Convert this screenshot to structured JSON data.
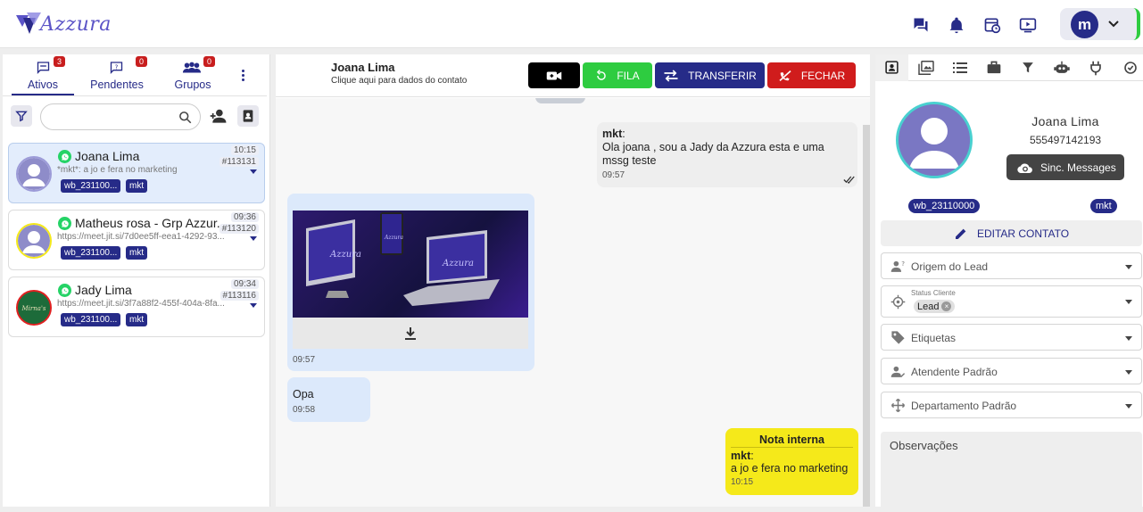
{
  "brand": {
    "name": "Azzura"
  },
  "profile": {
    "initial": "m"
  },
  "left": {
    "tabs": [
      {
        "label": "Ativos",
        "count": "3"
      },
      {
        "label": "Pendentes",
        "count": "0"
      },
      {
        "label": "Grupos",
        "count": "0"
      }
    ],
    "search": {
      "placeholder": "",
      "value": ""
    },
    "tickets": [
      {
        "name": "Joana Lima",
        "message": "*mkt*: a jo e fera no marketing",
        "time": "10:15",
        "number": "#113131",
        "tags": [
          "wb_231100...",
          "mkt"
        ]
      },
      {
        "name": "Matheus rosa - Grp Azzur...",
        "message": "https://meet.jit.si/7d0ee5ff-eea1-4292-93...",
        "time": "09:36",
        "number": "#113120",
        "tags": [
          "wb_231100...",
          "mkt"
        ]
      },
      {
        "name": "Jady Lima",
        "message": "https://meet.jit.si/3f7a88f2-455f-404a-8fa...",
        "time": "09:34",
        "number": "#113116",
        "tags": [
          "wb_231100...",
          "mkt"
        ]
      }
    ]
  },
  "chat": {
    "contact_name": "Joana Lima",
    "contact_sub": "Clique aqui para dados do contato",
    "buttons": {
      "queue": "FILA",
      "transfer": "TRANSFERIR",
      "close": "FECHAR"
    },
    "messages": [
      {
        "author": "mkt",
        "text": "Ola joana , sou a Jady da Azzura esta e uma mssg teste",
        "time": "09:57"
      },
      {
        "type": "image",
        "caption": "Azzura",
        "time": "09:57"
      },
      {
        "text": "Opa",
        "time": "09:58"
      },
      {
        "title": "Nota interna",
        "author": "mkt",
        "text": "a jo e fera no marketing",
        "time": "10:15"
      }
    ]
  },
  "contact": {
    "name": "Joana Lima",
    "phone": "555497142193",
    "sync_label": "Sinc. Messages",
    "tags": [
      "wb_23110000",
      "mkt"
    ],
    "edit_label": "EDITAR CONTATO",
    "fields": {
      "lead_origin": "Origem do Lead",
      "status_label": "Status Cliente",
      "status_value": "Lead",
      "labels": "Etiquetas",
      "default_attendant": "Atendente Padrão",
      "default_department": "Departamento Padrão"
    },
    "notes_label": "Observações"
  },
  "colors": {
    "primary": "#262b88",
    "green": "#2ecc40",
    "red": "#d01c1c",
    "note": "#f5e91a"
  }
}
